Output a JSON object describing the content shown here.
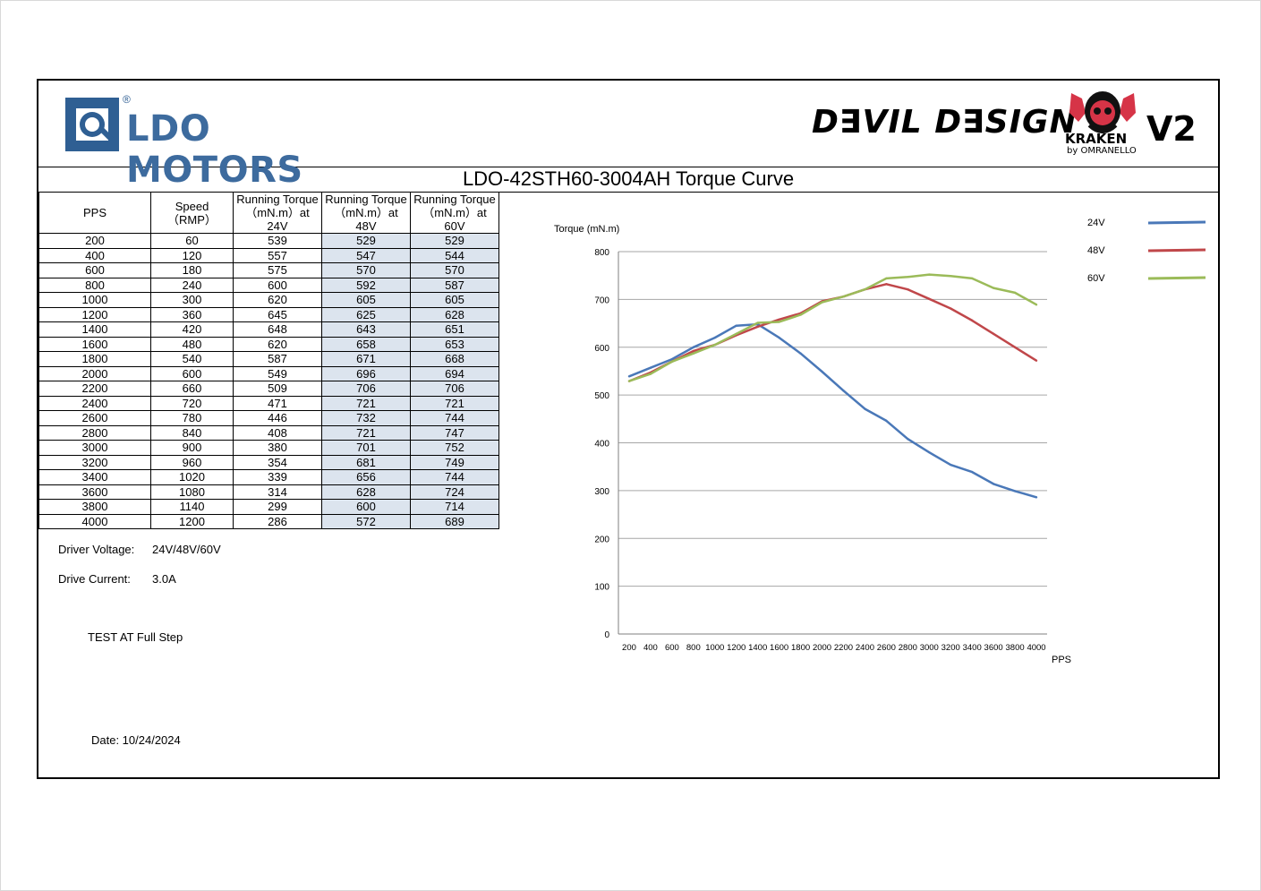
{
  "header": {
    "ldo_brand": "LDO MOTORS",
    "ldo_reg": "®",
    "devil_brand": "D∃VIL D∃SIGN",
    "kraken_word": "KRAKEN",
    "kraken_by": "by OMRANELLO",
    "version": "V2"
  },
  "title": "LDO-42STH60-3004AH Torque Curve",
  "table": {
    "headers": [
      "PPS",
      "Speed\n（RMP）",
      "Running Torque\n（mN.m）at\n24V",
      "Running Torque\n（mN.m）at\n48V",
      "Running Torque\n（mN.m）at\n60V"
    ],
    "rows": [
      [
        "200",
        "60",
        "539",
        "529",
        "529"
      ],
      [
        "400",
        "120",
        "557",
        "547",
        "544"
      ],
      [
        "600",
        "180",
        "575",
        "570",
        "570"
      ],
      [
        "800",
        "240",
        "600",
        "592",
        "587"
      ],
      [
        "1000",
        "300",
        "620",
        "605",
        "605"
      ],
      [
        "1200",
        "360",
        "645",
        "625",
        "628"
      ],
      [
        "1400",
        "420",
        "648",
        "643",
        "651"
      ],
      [
        "1600",
        "480",
        "620",
        "658",
        "653"
      ],
      [
        "1800",
        "540",
        "587",
        "671",
        "668"
      ],
      [
        "2000",
        "600",
        "549",
        "696",
        "694"
      ],
      [
        "2200",
        "660",
        "509",
        "706",
        "706"
      ],
      [
        "2400",
        "720",
        "471",
        "721",
        "721"
      ],
      [
        "2600",
        "780",
        "446",
        "732",
        "744"
      ],
      [
        "2800",
        "840",
        "408",
        "721",
        "747"
      ],
      [
        "3000",
        "900",
        "380",
        "701",
        "752"
      ],
      [
        "3200",
        "960",
        "354",
        "681",
        "749"
      ],
      [
        "3400",
        "1020",
        "339",
        "656",
        "744"
      ],
      [
        "3600",
        "1080",
        "314",
        "628",
        "724"
      ],
      [
        "3800",
        "1140",
        "299",
        "600",
        "714"
      ],
      [
        "4000",
        "1200",
        "286",
        "572",
        "689"
      ]
    ]
  },
  "info": {
    "voltage_label": "Driver Voltage:",
    "voltage_value": "24V/48V/60V",
    "current_label": "Drive Current:",
    "current_value": "3.0A",
    "test_note": "TEST AT Full Step",
    "date": "Date: 10/24/2024"
  },
  "chart_data": {
    "type": "line",
    "ylabel": "Torque (mN.m)",
    "xlabel": "PPS",
    "ylim": [
      0,
      800
    ],
    "yticks": [
      0,
      100,
      200,
      300,
      400,
      500,
      600,
      700,
      800
    ],
    "grid": true,
    "legend_position": "top-right",
    "categories": [
      "200",
      "400",
      "600",
      "800",
      "1000",
      "1200",
      "1400",
      "1600",
      "1800",
      "2000",
      "2200",
      "2400",
      "2600",
      "2800",
      "3000",
      "3200",
      "3400",
      "3600",
      "3800",
      "4000"
    ],
    "series": [
      {
        "name": "24V",
        "color": "#4a78b8",
        "values": [
          539,
          557,
          575,
          600,
          620,
          645,
          648,
          620,
          587,
          549,
          509,
          471,
          446,
          408,
          380,
          354,
          339,
          314,
          299,
          286
        ]
      },
      {
        "name": "48V",
        "color": "#c0474a",
        "values": [
          529,
          547,
          570,
          592,
          605,
          625,
          643,
          658,
          671,
          696,
          706,
          721,
          732,
          721,
          701,
          681,
          656,
          628,
          600,
          572
        ]
      },
      {
        "name": "60V",
        "color": "#9bbb59",
        "values": [
          529,
          544,
          570,
          587,
          605,
          628,
          651,
          653,
          668,
          694,
          706,
          721,
          744,
          747,
          752,
          749,
          744,
          724,
          714,
          689
        ]
      }
    ]
  }
}
